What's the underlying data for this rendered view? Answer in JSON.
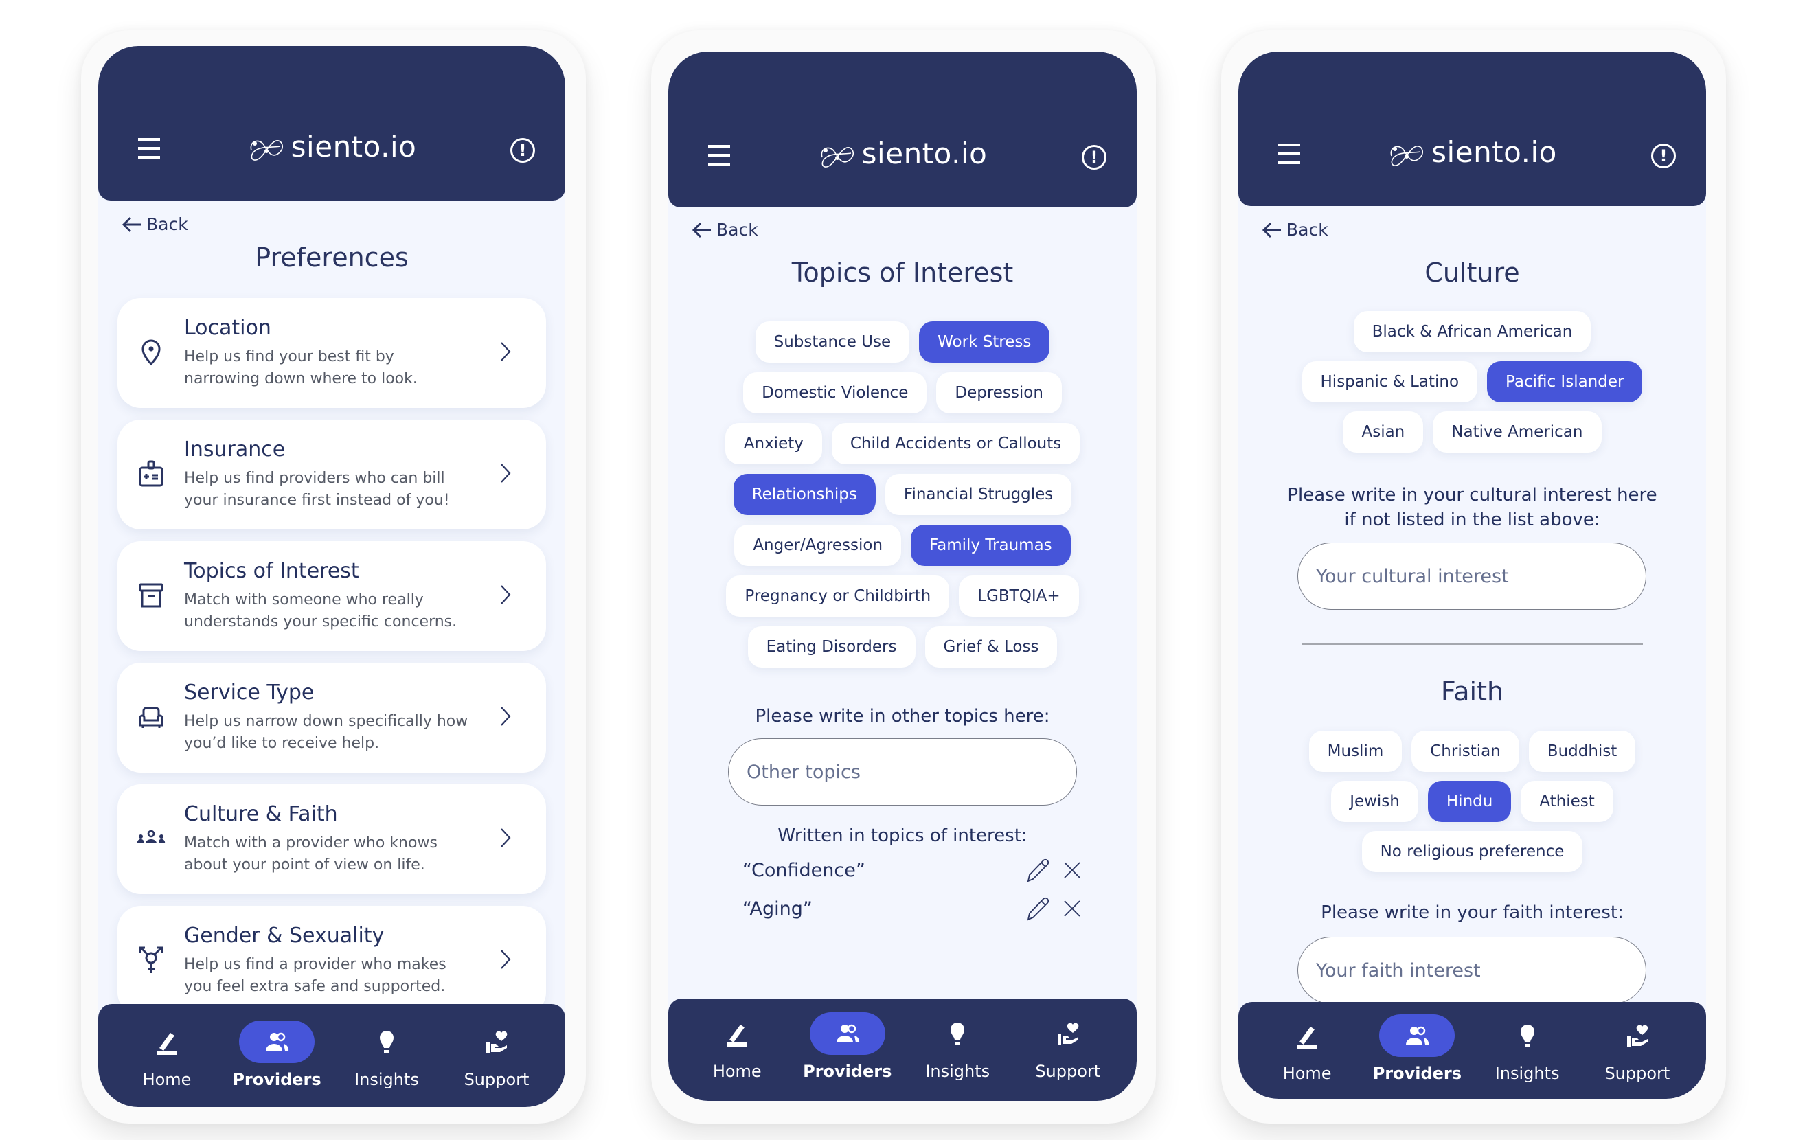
{
  "app": {
    "brand": "siento.io",
    "colors": {
      "primary": "#2a3461",
      "accent": "#4655d9",
      "background": "#f3f6fe"
    }
  },
  "nav": {
    "items": [
      {
        "label": "Home",
        "icon": "pencil-icon"
      },
      {
        "label": "Providers",
        "icon": "users-icon",
        "active": true
      },
      {
        "label": "Insights",
        "icon": "lightbulb-icon"
      },
      {
        "label": "Support",
        "icon": "hand-heart-icon"
      }
    ]
  },
  "screen1": {
    "back": "Back",
    "title": "Preferences",
    "cards": [
      {
        "title": "Location",
        "desc": "Help us find your best fit by narrowing down where to look.",
        "icon": "map-pin-icon"
      },
      {
        "title": "Insurance",
        "desc": "Help us find providers who can bill your insurance first instead of you!",
        "icon": "insurance-badge-icon"
      },
      {
        "title": "Topics of Interest",
        "desc": "Match with someone who really understands your specific concerns.",
        "icon": "archive-box-icon"
      },
      {
        "title": "Service Type",
        "desc": "Help us narrow down specifically how you’d like to receive help.",
        "icon": "couch-icon"
      },
      {
        "title": "Culture & Faith",
        "desc": "Match with a provider who knows about your point of view on life.",
        "icon": "community-icon"
      },
      {
        "title": "Gender & Sexuality",
        "desc": "Help us find a provider who makes you feel extra safe and supported.",
        "icon": "gender-icon"
      }
    ]
  },
  "screen2": {
    "back": "Back",
    "title": "Topics of Interest",
    "chip_rows": [
      [
        {
          "label": "Substance Use",
          "selected": false
        },
        {
          "label": "Work Stress",
          "selected": true
        }
      ],
      [
        {
          "label": "Domestic Violence",
          "selected": false
        },
        {
          "label": "Depression",
          "selected": false
        }
      ],
      [
        {
          "label": "Anxiety",
          "selected": false
        },
        {
          "label": "Child Accidents or Callouts",
          "selected": false
        }
      ],
      [
        {
          "label": "Relationships",
          "selected": true
        },
        {
          "label": "Financial Struggles",
          "selected": false
        }
      ],
      [
        {
          "label": "Anger/Agression",
          "selected": false
        },
        {
          "label": "Family Traumas",
          "selected": true
        }
      ],
      [
        {
          "label": "Pregnancy or Childbirth",
          "selected": false
        },
        {
          "label": "LGBTQIA+",
          "selected": false
        }
      ],
      [
        {
          "label": "Eating Disorders",
          "selected": false
        },
        {
          "label": "Grief & Loss",
          "selected": false
        }
      ]
    ],
    "other_label": "Please write in other topics here:",
    "other_placeholder": "Other topics",
    "other_value": "",
    "written_label": "Written in topics of interest:",
    "written": [
      "“Confidence”",
      "“Aging”"
    ]
  },
  "screen3": {
    "back": "Back",
    "culture_title": "Culture",
    "culture_rows": [
      [
        {
          "label": "Black & African American",
          "selected": false
        }
      ],
      [
        {
          "label": "Hispanic & Latino",
          "selected": false
        },
        {
          "label": "Pacific Islander",
          "selected": true
        }
      ],
      [
        {
          "label": "Asian",
          "selected": false
        },
        {
          "label": "Native American",
          "selected": false
        }
      ]
    ],
    "culture_label_1": "Please write in your cultural interest here",
    "culture_label_2": "if not listed in the list above:",
    "culture_placeholder": "Your cultural interest",
    "culture_value": "",
    "faith_title": "Faith",
    "faith_rows": [
      [
        {
          "label": "Muslim",
          "selected": false
        },
        {
          "label": "Christian",
          "selected": false
        },
        {
          "label": "Buddhist",
          "selected": false
        }
      ],
      [
        {
          "label": "Jewish",
          "selected": false
        },
        {
          "label": "Hindu",
          "selected": true
        },
        {
          "label": "Athiest",
          "selected": false
        }
      ],
      [
        {
          "label": "No religious preference",
          "selected": false
        }
      ]
    ],
    "faith_label": "Please write in your faith interest:",
    "faith_placeholder": "Your faith interest",
    "faith_value": ""
  }
}
